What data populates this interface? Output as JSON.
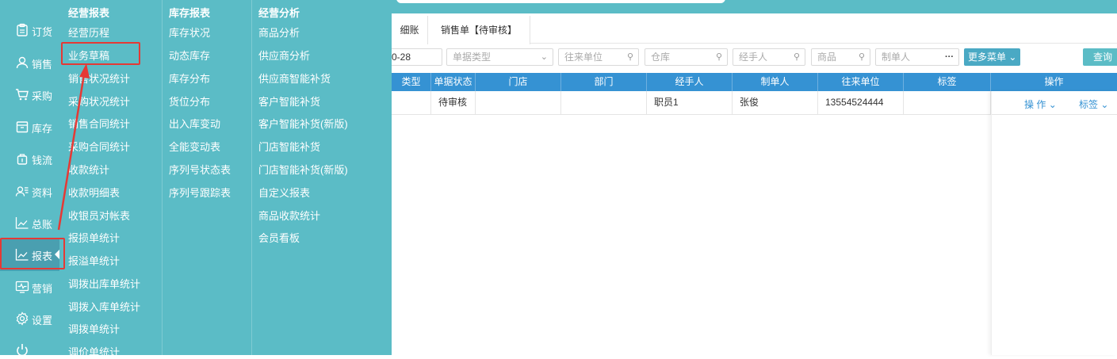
{
  "nav": {
    "items": [
      {
        "label": "订货",
        "icon": "clipboard-icon"
      },
      {
        "label": "销售",
        "icon": "user-icon"
      },
      {
        "label": "采购",
        "icon": "cart-icon"
      },
      {
        "label": "库存",
        "icon": "box-icon"
      },
      {
        "label": "钱流",
        "icon": "money-bag-icon"
      },
      {
        "label": "资料",
        "icon": "contacts-icon"
      },
      {
        "label": "总账",
        "icon": "chart-line-icon"
      },
      {
        "label": "报表",
        "icon": "chart-line-icon"
      },
      {
        "label": "营销",
        "icon": "monitor-pulse-icon"
      },
      {
        "label": "设置",
        "icon": "gear-icon"
      }
    ]
  },
  "menu": {
    "col1": {
      "heading": "经营报表",
      "items": [
        "经营历程",
        "业务草稿",
        "销售状况统计",
        "采购状况统计",
        "销售合同统计",
        "采购合同统计",
        "收款统计",
        "收款明细表",
        "收银员对帐表",
        "报损单统计",
        "报溢单统计",
        "调拨出库单统计",
        "调拨入库单统计",
        "调拨单统计",
        "调价单统计"
      ]
    },
    "col2": {
      "heading": "库存报表",
      "items": [
        "库存状况",
        "动态库存",
        "库存分布",
        "货位分布",
        "出入库变动",
        "全能变动表",
        "序列号状态表",
        "序列号跟踪表"
      ]
    },
    "col3": {
      "heading": "经营分析",
      "items": [
        "商品分析",
        "供应商分析",
        "供应商智能补货",
        "客户智能补货",
        "客户智能补货(新版)",
        "门店智能补货",
        "门店智能补货(新版)",
        "自定义报表",
        "商品收款统计",
        "会员看板"
      ]
    }
  },
  "tabs": [
    "细账",
    "销售单【待审核】"
  ],
  "filters": {
    "date_fragment": "0-28",
    "doc_type": "单据类型",
    "partner": "往来单位",
    "warehouse": "仓库",
    "handler": "经手人",
    "product": "商品",
    "creator": "制单人",
    "more_label": "更多菜单",
    "query_label": "查询"
  },
  "table": {
    "headers": [
      "类型",
      "单据状态",
      "门店",
      "部门",
      "经手人",
      "制单人",
      "往来单位",
      "标签",
      "操作"
    ],
    "rows": [
      {
        "type": "",
        "status": "待审核",
        "store": "",
        "dept": "",
        "handler": "职员1",
        "creator": "张俊",
        "partner": "13554524444",
        "tag": ""
      }
    ],
    "ops": [
      "操 作",
      "标签"
    ]
  },
  "colors": {
    "teal": "#5bbcc6",
    "header_blue": "#3592d3",
    "highlight_red": "#e53935"
  }
}
